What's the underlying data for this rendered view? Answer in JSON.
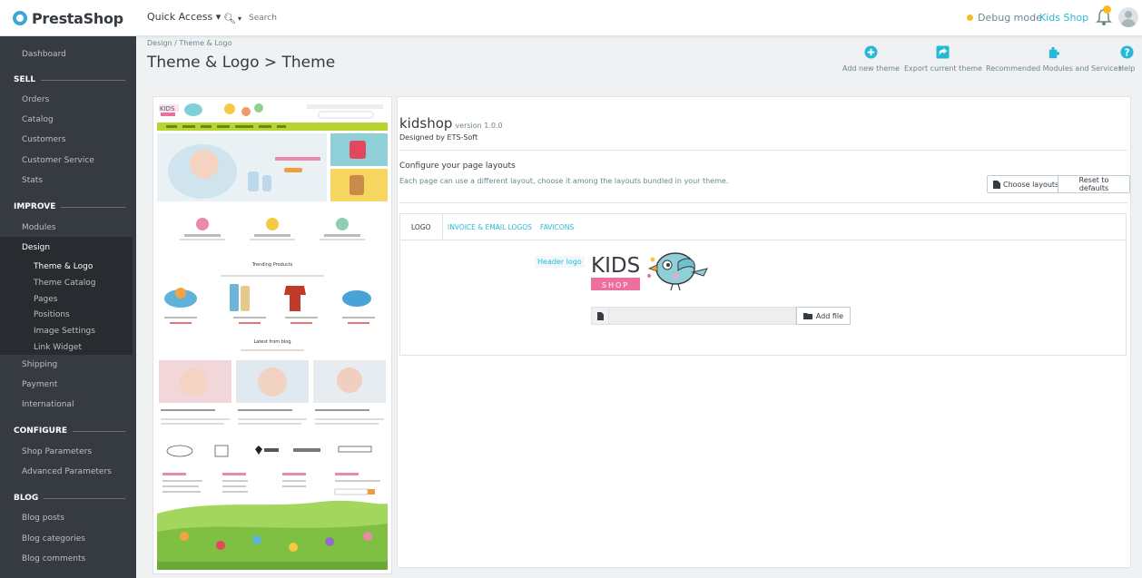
{
  "brand": {
    "name": "PrestaShop"
  },
  "topbar": {
    "quick_access": "Quick Access ▾",
    "search_placeholder": "Search",
    "debug_mode": "Debug mode",
    "shop_name": "Kids Shop"
  },
  "sidebar": {
    "dashboard": "Dashboard",
    "sections": {
      "sell": "SELL",
      "improve": "IMPROVE",
      "configure": "CONFIGURE",
      "blog": "BLOG"
    },
    "sell_items": [
      "Orders",
      "Catalog",
      "Customers",
      "Customer Service",
      "Stats"
    ],
    "improve_items": [
      "Modules",
      "Design"
    ],
    "design_sub": [
      "Theme & Logo",
      "Theme Catalog",
      "Pages",
      "Positions",
      "Image Settings",
      "Link Widget"
    ],
    "after_design": [
      "Shipping",
      "Payment",
      "International"
    ],
    "configure_items": [
      "Shop Parameters",
      "Advanced Parameters"
    ],
    "blog_items": [
      "Blog posts",
      "Blog categories",
      "Blog comments"
    ]
  },
  "header": {
    "breadcrumb": "Design  /  Theme & Logo",
    "title": "Theme & Logo > Theme",
    "toolbar": {
      "add_theme": "Add new theme",
      "export_theme": "Export current theme",
      "recommended": "Recommended Modules and Services",
      "help": "Help"
    }
  },
  "theme": {
    "name": "kidshop",
    "version": "version 1.0.0",
    "designed_by": "Designed by ETS-Soft",
    "layouts_title": "Configure your page layouts",
    "layouts_desc": "Each page can use a different layout, choose it among the layouts bundled in your theme.",
    "choose_layouts": "Choose layouts",
    "reset_defaults": "Reset to defaults"
  },
  "tabs": [
    "LOGO",
    "INVOICE & EMAIL LOGOS",
    "FAVICONS"
  ],
  "logo_tab": {
    "header_logo_label": "Header logo",
    "logo_word_top": "KIDS",
    "logo_word_bottom": "SHOP",
    "add_file": "Add file"
  },
  "preview": {
    "logo_top": "KIDS",
    "trending": "Trending Products",
    "latest_blog": "Latest from blog"
  },
  "colors": {
    "sidebar_bg": "#363a41",
    "accent": "#25b9d7",
    "kids_pink": "#ec6fa0",
    "kids_green": "#b7d432"
  }
}
